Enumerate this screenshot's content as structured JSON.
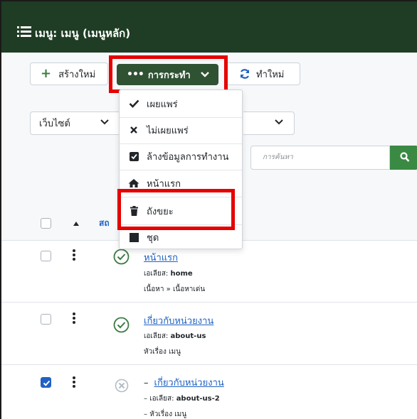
{
  "header": {
    "title": "เมนู: เมนู (เมนูหลัก)"
  },
  "toolbar": {
    "new_label": "สร้างใหม่",
    "actions_label": "การกระทำ",
    "rebuild_label": "ทำใหม่"
  },
  "filters": {
    "site_select_value": "เว็บไซต์",
    "search_placeholder": "การค้นหา"
  },
  "actions_menu": {
    "items": [
      {
        "label": "เผยแพร่",
        "icon": "check-icon"
      },
      {
        "label": "ไม่เผยแพร่",
        "icon": "x-icon"
      },
      {
        "label": "ล้างข้อมูลการทำงาน",
        "icon": "checkbox-icon"
      },
      {
        "label": "หน้าแรก",
        "icon": "home-icon"
      },
      {
        "label": "ถังขยะ",
        "icon": "trash-icon"
      },
      {
        "label": "ชุด",
        "icon": "square-icon"
      }
    ]
  },
  "table": {
    "status_header": "สถ",
    "rows": [
      {
        "title": "หน้าแรก",
        "alias_label": "เอเลียส:",
        "alias": "home",
        "link": "เนื้อหา » เนื้อหาเด่น",
        "checked": false,
        "published": true
      },
      {
        "title": "เกี่ยวกับหน่วยงาน",
        "alias_label": "เอเลียส:",
        "alias": "about-us",
        "link": "หัวเรื่อง เมนู",
        "checked": false,
        "published": true
      },
      {
        "title": "เกี่ยวกับหน่วยงาน",
        "prefix": "–",
        "alias_label": "เอเลียส:",
        "alias": "about-us-2",
        "link": "หัวเรื่อง เมนู",
        "checked": true,
        "published": false
      }
    ]
  },
  "colors": {
    "header_bg": "#1f3d24",
    "actions_bg": "#2f5233",
    "highlight_red": "#e60000",
    "link_blue": "#1f62c3",
    "search_green": "#3a8a44",
    "published_green": "#3d7b44"
  }
}
